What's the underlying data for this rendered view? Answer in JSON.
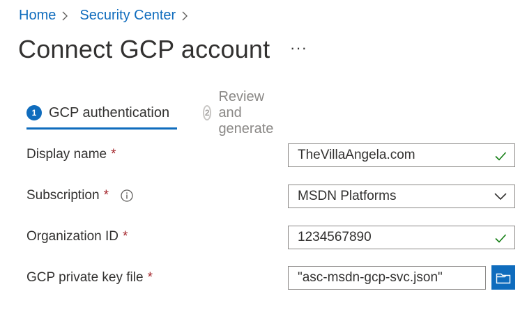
{
  "breadcrumb": {
    "home": "Home",
    "security_center": "Security Center"
  },
  "page": {
    "title": "Connect GCP account",
    "more": "···"
  },
  "tabs": [
    {
      "number": "1",
      "label": "GCP authentication",
      "active": true
    },
    {
      "number": "2",
      "label": "Review and generate",
      "active": false
    }
  ],
  "form": {
    "required_marker": "*",
    "display_name": {
      "label": "Display name",
      "value": "TheVillaAngela.com",
      "status_icon": "check-icon"
    },
    "subscription": {
      "label": "Subscription",
      "value": "MSDN Platforms",
      "info_icon": "info-icon",
      "dropdown_icon": "chevron-down-icon"
    },
    "organization_id": {
      "label": "Organization ID",
      "value": "1234567890",
      "status_icon": "check-icon"
    },
    "private_key": {
      "label": "GCP private key file",
      "value": "\"asc-msdn-gcp-svc.json\"",
      "browse_icon": "folder-icon"
    }
  },
  "colors": {
    "accent": "#0f6cbd",
    "required": "#a4262c",
    "success": "#107c10"
  }
}
